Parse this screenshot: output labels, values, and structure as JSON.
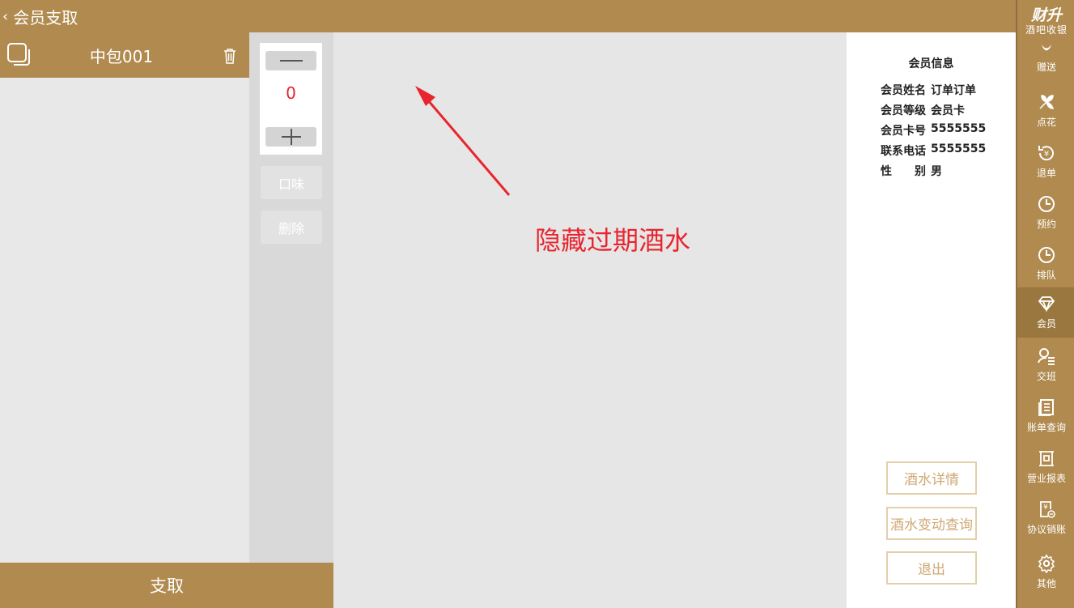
{
  "topbar": {
    "back_glyph": "‹",
    "title": "会员支取"
  },
  "room": {
    "name": "中包001"
  },
  "stepper": {
    "quantity": "0"
  },
  "actions": {
    "flavor": "口味",
    "delete": "删除"
  },
  "withdraw_label": "支取",
  "annotation": {
    "text": "隐藏过期酒水",
    "color": "#e8252f"
  },
  "member_info": {
    "title": "会员信息",
    "rows": [
      {
        "label": "会员姓名",
        "value": "订单订单"
      },
      {
        "label": "会员等级",
        "value": "会员卡"
      },
      {
        "label": "会员卡号",
        "value": "5555555"
      },
      {
        "label": "联系电话",
        "value": "5555555"
      },
      {
        "label": "性　　别",
        "value": "男"
      }
    ],
    "buttons": {
      "wine_detail": "酒水详情",
      "wine_change_query": "酒水变动查询",
      "exit": "退出"
    }
  },
  "brand": {
    "logo": "财升",
    "subtitle": "酒吧收银"
  },
  "nav": [
    {
      "label": "赠送",
      "icon": "gift-icon"
    },
    {
      "label": "点花",
      "icon": "flower-icon"
    },
    {
      "label": "退单",
      "icon": "refund-icon"
    },
    {
      "label": "预约",
      "icon": "clock-icon"
    },
    {
      "label": "排队",
      "icon": "clock-icon"
    },
    {
      "label": "会员",
      "icon": "diamond-icon",
      "active": true
    },
    {
      "label": "交班",
      "icon": "handover-icon"
    },
    {
      "label": "账单查询",
      "icon": "bill-icon"
    },
    {
      "label": "营业报表",
      "icon": "report-icon"
    },
    {
      "label": "协议销账",
      "icon": "agreement-icon"
    },
    {
      "label": "其他",
      "icon": "gear-icon"
    }
  ],
  "colors": {
    "primary": "#b08a4f",
    "accent_red": "#e8252f",
    "button_border": "#e3cfa9"
  }
}
